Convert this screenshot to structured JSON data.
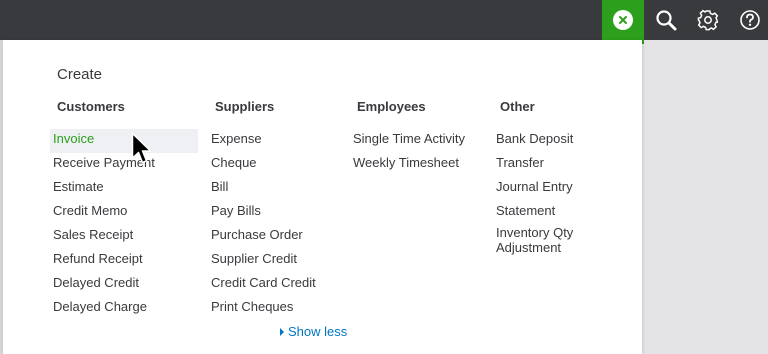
{
  "topbar": {
    "icons": [
      "close-icon",
      "search-icon",
      "gear-icon",
      "help-icon"
    ]
  },
  "create": {
    "title": "Create",
    "columns": [
      {
        "header": "Customers",
        "items": [
          "Invoice",
          "Receive Payment",
          "Estimate",
          "Credit Memo",
          "Sales Receipt",
          "Refund Receipt",
          "Delayed Credit",
          "Delayed Charge"
        ]
      },
      {
        "header": "Suppliers",
        "items": [
          "Expense",
          "Cheque",
          "Bill",
          "Pay Bills",
          "Purchase Order",
          "Supplier Credit",
          "Credit Card Credit",
          "Print Cheques"
        ]
      },
      {
        "header": "Employees",
        "items": [
          "Single Time Activity",
          "Weekly Timesheet"
        ]
      },
      {
        "header": "Other",
        "items": [
          "Bank Deposit",
          "Transfer",
          "Journal Entry",
          "Statement",
          "Inventory Qty Adjustment"
        ]
      }
    ],
    "show_less": "Show less"
  },
  "colors": {
    "topbar": "#393a3d",
    "accent_green": "#2ca01c",
    "link_blue": "#0077c5",
    "text": "#393a3d"
  }
}
